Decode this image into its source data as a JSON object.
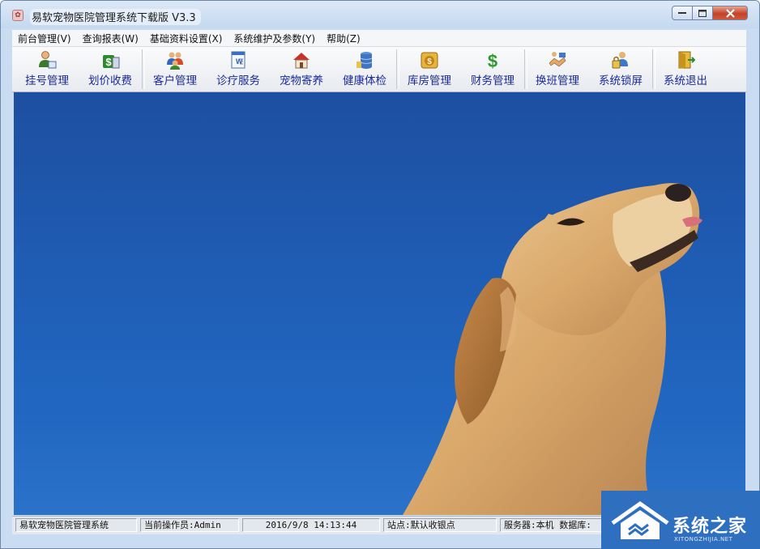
{
  "window": {
    "title": "易软宠物医院管理系统下载版 V3.3"
  },
  "menubar": [
    "前台管理(V)",
    "查询报表(W)",
    "基础资料设置(X)",
    "系统维护及参数(Y)",
    "帮助(Z)"
  ],
  "toolbar": {
    "buttons": [
      {
        "label": "挂号管理",
        "icon": "user-register-icon"
      },
      {
        "label": "划价收费",
        "icon": "money-calculator-icon"
      },
      {
        "label": "客户管理",
        "icon": "customers-icon"
      },
      {
        "label": "诊疗服务",
        "icon": "document-icon"
      },
      {
        "label": "宠物寄养",
        "icon": "house-icon"
      },
      {
        "label": "健康体检",
        "icon": "database-icon"
      },
      {
        "label": "库房管理",
        "icon": "money-bag-icon"
      },
      {
        "label": "财务管理",
        "icon": "dollar-icon"
      },
      {
        "label": "换班管理",
        "icon": "handshake-icon"
      },
      {
        "label": "系统锁屏",
        "icon": "lock-user-icon"
      },
      {
        "label": "系统退出",
        "icon": "exit-door-icon"
      }
    ]
  },
  "statusbar": {
    "app_name": "易软宠物医院管理系统",
    "operator": "当前操作员:Admin",
    "datetime": "2016/9/8 14:13:44",
    "station": "站点:默认收银点",
    "server": "服务器:本机  数据库:"
  },
  "watermark": {
    "text": "系统之家",
    "sub": "XITONGZHIJIA.NET"
  },
  "colors": {
    "desktop_blue": "#1f5cb3",
    "toolbar_label": "#1a2a9a",
    "close_red": "#c2432a"
  }
}
